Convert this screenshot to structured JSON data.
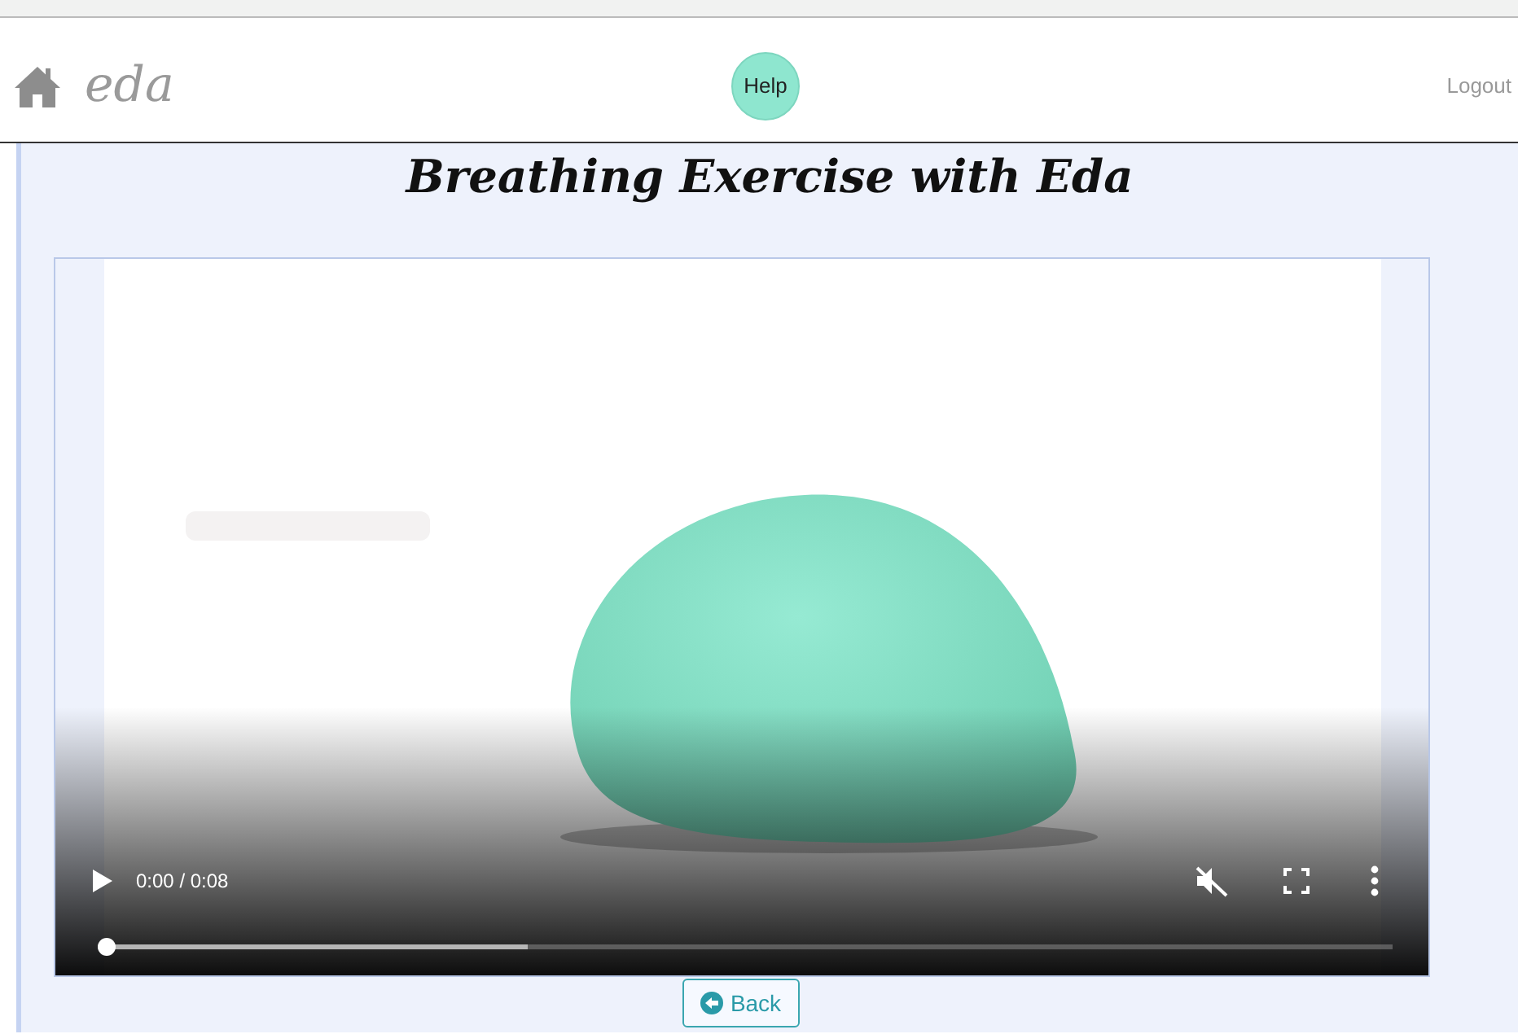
{
  "header": {
    "brand": "eda",
    "help_button": "Help",
    "logout_link": "Logout"
  },
  "title": "Breathing Exercise with Eda",
  "video": {
    "kind": "picture",
    "time": "0:00 / 0:08",
    "muted": true,
    "seek_bar": {
      "level": 0
    },
    "buffer_bar": {
      "level": 0.33
    }
  },
  "back_button": "Back"
}
